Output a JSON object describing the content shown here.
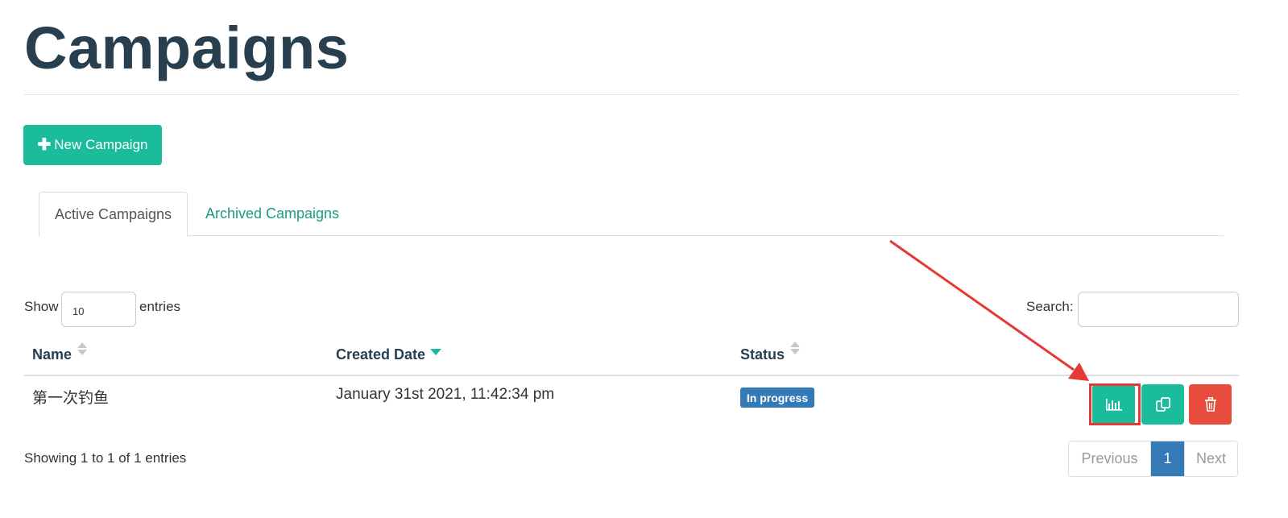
{
  "page": {
    "title": "Campaigns"
  },
  "toolbar": {
    "new_campaign_label": "New Campaign"
  },
  "tabs": [
    {
      "label": "Active Campaigns",
      "active": true
    },
    {
      "label": "Archived Campaigns",
      "active": false
    }
  ],
  "table_controls": {
    "show_label": "Show",
    "page_length": "10",
    "entries_label": "entries",
    "search_label": "Search:",
    "search_value": ""
  },
  "table": {
    "columns": [
      "Name",
      "Created Date",
      "Status"
    ],
    "sorted_column": "Created Date",
    "rows": [
      {
        "name": "第一次钓鱼",
        "created_date": "January 31st 2021, 11:42:34 pm",
        "status": "In progress"
      }
    ]
  },
  "footer": {
    "info": "Showing 1 to 1 of 1 entries",
    "previous_label": "Previous",
    "current_page": "1",
    "next_label": "Next"
  },
  "icons": {
    "new": "plus-icon",
    "results": "bar-chart-icon",
    "copy": "copy-icon",
    "delete": "trash-icon"
  },
  "colors": {
    "accent": "#1abc9c",
    "danger": "#e74c3c",
    "primary": "#337ab7",
    "heading": "#283f50",
    "annotation": "#e53935"
  }
}
